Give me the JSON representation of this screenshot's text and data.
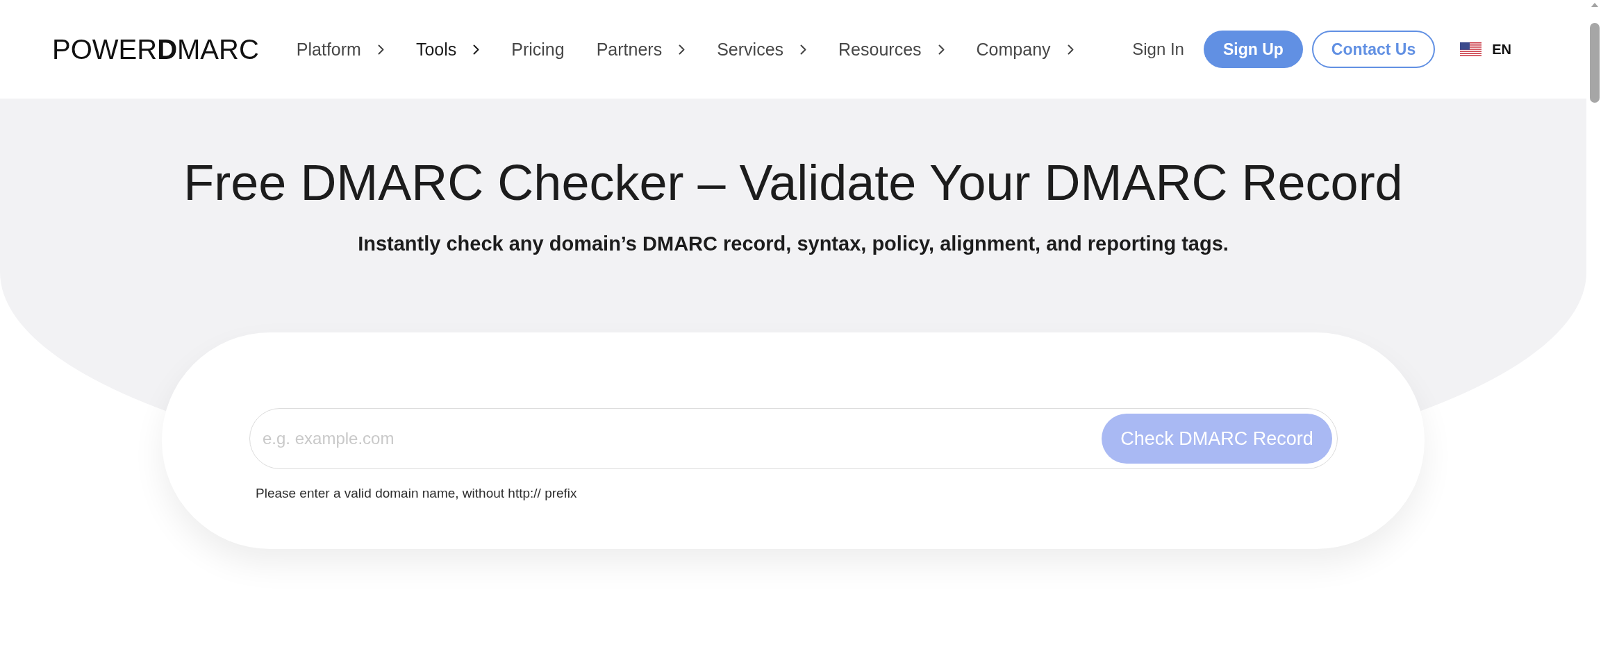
{
  "header": {
    "logo": "POWER**D**MARC",
    "nav": [
      {
        "label": "Platform",
        "submenu": true,
        "selected": false
      },
      {
        "label": "Tools",
        "submenu": true,
        "selected": true
      },
      {
        "label": "Pricing",
        "submenu": false,
        "selected": false
      },
      {
        "label": "Partners",
        "submenu": true,
        "selected": false
      },
      {
        "label": "Services",
        "submenu": true,
        "selected": false
      },
      {
        "label": "Resources",
        "submenu": true,
        "selected": false
      },
      {
        "label": "Company",
        "submenu": true,
        "selected": false
      }
    ],
    "sign_in": "Sign In",
    "sign_up": "Sign Up",
    "contact": "Contact Us",
    "language": "EN"
  },
  "hero": {
    "title": "Free DMARC Checker – Validate Your DMARC Record",
    "subtitle": "Instantly check any domain’s DMARC record, syntax, policy, alignment, and reporting tags."
  },
  "checker": {
    "placeholder": "e.g. example.com",
    "button": {
      "label": "Check DMARC Record",
      "disabled": true
    },
    "hint": "Please enter a valid domain name, without http:// prefix"
  }
}
